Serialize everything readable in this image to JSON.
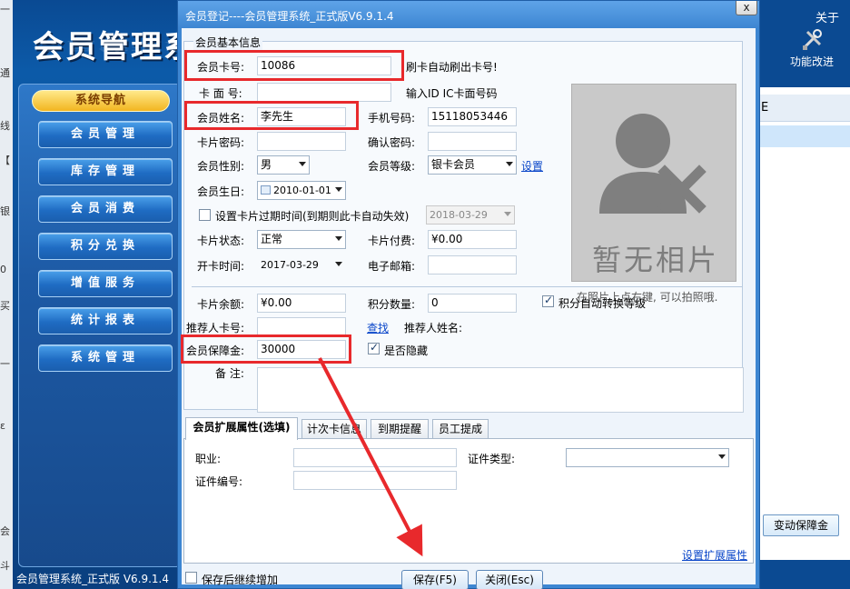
{
  "background_app": {
    "title": "会员管理系统",
    "nav_header": "系统导航",
    "nav_items": [
      "会员管理",
      "库存管理",
      "会员消费",
      "积分兑换",
      "增值服务",
      "统计报表",
      "系统管理"
    ],
    "status_text": "会员管理系统_正式版 V6.9.1.4",
    "about_label": "关于",
    "improve_label": "功能改进",
    "right_partial_text": "E",
    "change_deposit_button": "变动保障金",
    "left_strip_fragments": [
      "一",
      "通",
      "线",
      "【",
      "银",
      "0",
      "买",
      "一",
      "ε",
      "会",
      "斗"
    ]
  },
  "dialog": {
    "title": "会员登记----会员管理系统_正式版V6.9.1.4",
    "close_label": "x",
    "group_title": "会员基本信息",
    "card_no": {
      "label": "会员卡号:",
      "value": "10086",
      "hint": "刷卡自动刷出卡号!"
    },
    "card_face_no": {
      "label": "卡 面 号:",
      "value": "",
      "hint": "输入ID IC卡面号码"
    },
    "member_name": {
      "label": "会员姓名:",
      "value": "李先生"
    },
    "phone": {
      "label": "手机号码:",
      "value": "15118053446"
    },
    "card_password": {
      "label": "卡片密码:",
      "value": ""
    },
    "confirm_password": {
      "label": "确认密码:",
      "value": ""
    },
    "gender": {
      "label": "会员性别:",
      "value": "男"
    },
    "level": {
      "label": "会员等级:",
      "value": "银卡会员",
      "link": "设置"
    },
    "birthday": {
      "label": "会员生日:",
      "value": "2010-01-01"
    },
    "expiry": {
      "label": "设置卡片过期时间(到期则此卡自动失效)",
      "value": "2018-03-29",
      "checked": false
    },
    "card_status": {
      "label": "卡片状态:",
      "value": "正常"
    },
    "card_fee": {
      "label": "卡片付费:",
      "value": "¥0.00"
    },
    "open_date": {
      "label": "开卡时间:",
      "value": "2017-03-29"
    },
    "email": {
      "label": "电子邮箱:",
      "value": ""
    },
    "photo": {
      "placeholder_text": "暂无相片",
      "caption": "在照片上点右键, 可以拍照哦."
    },
    "balance": {
      "label": "卡片余额:",
      "value": "¥0.00"
    },
    "points": {
      "label": "积分数量:",
      "value": "0"
    },
    "auto_level": {
      "label": "积分自动转换等级",
      "checked": true
    },
    "referrer_card": {
      "label": "推荐人卡号:",
      "value": "",
      "link": "查找",
      "name_label": "推荐人姓名:"
    },
    "deposit": {
      "label": "会员保障金:",
      "value": "30000"
    },
    "hidden": {
      "label": "是否隐藏",
      "checked": true
    },
    "remark": {
      "label": "备 注:",
      "value": ""
    },
    "tabs": [
      "会员扩展属性(选填)",
      "计次卡信息",
      "到期提醒",
      "员工提成"
    ],
    "ext": {
      "occupation_label": "职业:",
      "id_type_label": "证件类型:",
      "id_no_label": "证件编号:",
      "settings_link": "设置扩展属性"
    },
    "save_continue": {
      "label": "保存后继续增加",
      "checked": false
    },
    "save_button": "保存(F5)",
    "close_button": "关闭(Esc)"
  },
  "colors": {
    "highlight": "#e8292c",
    "dialog_blue": "#3d86d2",
    "link": "#0a46c9"
  }
}
